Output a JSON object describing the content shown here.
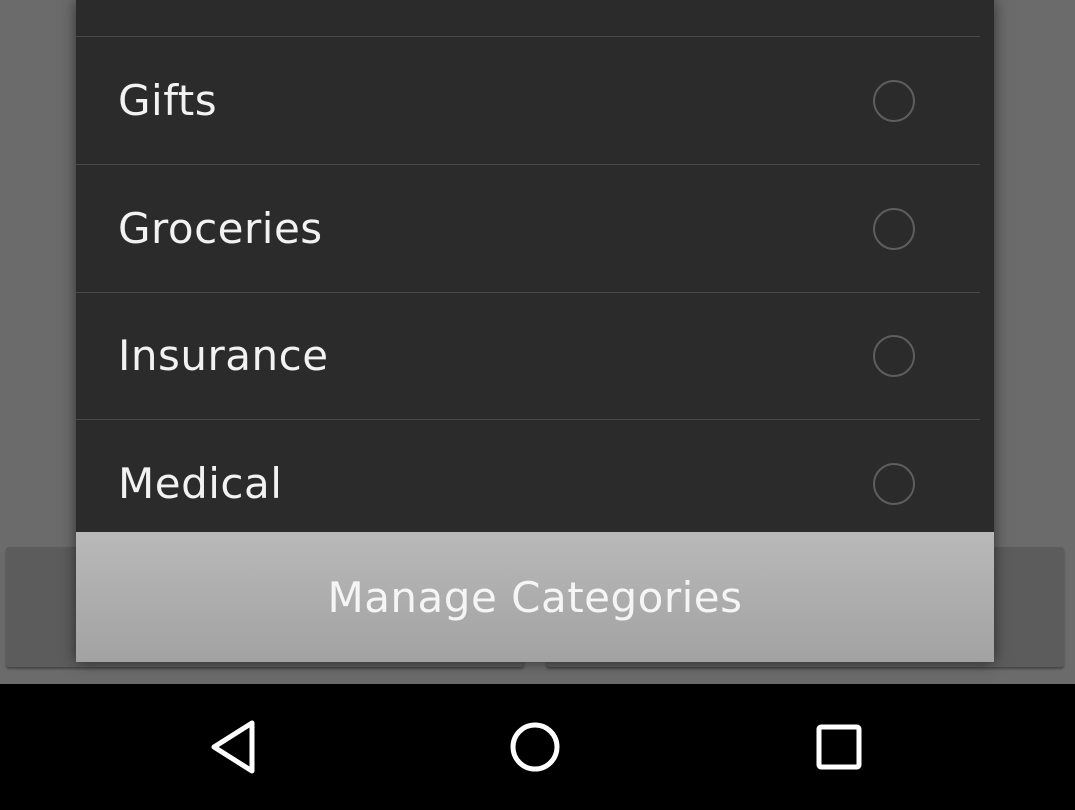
{
  "categories": [
    {
      "label": "Gifts",
      "selected": false
    },
    {
      "label": "Groceries",
      "selected": false
    },
    {
      "label": "Insurance",
      "selected": false
    },
    {
      "label": "Medical",
      "selected": false
    }
  ],
  "footer": {
    "manage_label": "Manage Categories"
  },
  "navbar": {
    "icons": [
      "back-icon",
      "home-icon",
      "recent-apps-icon"
    ]
  },
  "colors": {
    "dialog_bg": "#2b2b2b",
    "divider": "#4a4a4a",
    "manage_bg": "#ababab",
    "text": "#f2f2f2",
    "scrim": "#6b6b6b",
    "navbar_bg": "#000000"
  }
}
